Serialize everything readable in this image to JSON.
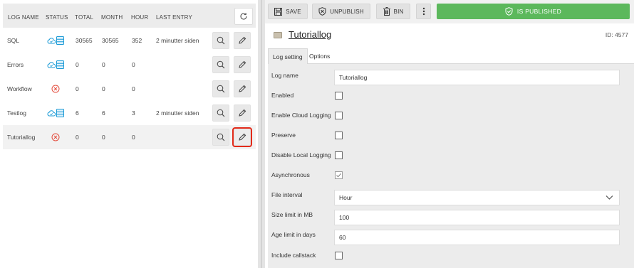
{
  "table": {
    "headers": [
      "LOG NAME",
      "STATUS",
      "TOTAL",
      "MONTH",
      "HOUR",
      "LAST ENTRY"
    ],
    "rows": [
      {
        "name": "SQL",
        "status": "cloud-local",
        "total": "30565",
        "month": "30565",
        "hour": "352",
        "last": "2 minutter siden"
      },
      {
        "name": "Errors",
        "status": "cloud-local",
        "total": "0",
        "month": "0",
        "hour": "0",
        "last": ""
      },
      {
        "name": "Workflow",
        "status": "disabled",
        "total": "0",
        "month": "0",
        "hour": "0",
        "last": ""
      },
      {
        "name": "Testlog",
        "status": "cloud-local",
        "total": "6",
        "month": "6",
        "hour": "3",
        "last": "2 minutter siden"
      },
      {
        "name": "Tutoriallog",
        "status": "disabled",
        "total": "0",
        "month": "0",
        "hour": "0",
        "last": ""
      }
    ]
  },
  "toolbar": {
    "save_label": "SAVE",
    "unpublish_label": "UNPUBLISH",
    "bin_label": "BIN",
    "published_label": "IS PUBLISHED"
  },
  "item": {
    "title": "Tutoriallog",
    "id": "ID: 4577"
  },
  "tabs": [
    "Log setting",
    "Options"
  ],
  "form": {
    "log_name_label": "Log name",
    "log_name_value": "Tutoriallog",
    "enabled_label": "Enabled",
    "enabled": false,
    "cloud_label": "Enable Cloud Logging",
    "cloud": false,
    "preserve_label": "Preserve",
    "preserve": false,
    "disable_local_label": "Disable Local Logging",
    "disable_local": false,
    "async_label": "Asynchronous",
    "async": true,
    "file_interval_label": "File interval",
    "file_interval_value": "Hour",
    "size_label": "Size limit in MB",
    "size_value": "100",
    "age_label": "Age limit in days",
    "age_value": "60",
    "callstack_label": "Include callstack",
    "callstack": false
  },
  "colors": {
    "published_green": "#5cb85c",
    "status_blue": "#1a9ad6",
    "status_red": "#e34a3b",
    "highlight_red": "#e32b1a"
  }
}
